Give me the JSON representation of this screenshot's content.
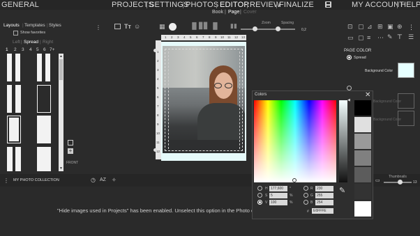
{
  "topnav": {
    "general": "GENERAL",
    "projects": "PROJECTS",
    "settings": "SETTINGS",
    "photos": "PHOTOS",
    "editor": "EDITOR",
    "review": "REVIEW",
    "finalize": "FINALIZE",
    "account": "MY ACCOUNT",
    "help": "HELP",
    "save_icon": "save-icon"
  },
  "subnav": {
    "book": "Book",
    "page": "Page",
    "cover": "Cover"
  },
  "left_tabs": {
    "layouts": "Layouts",
    "templates": "Templates",
    "styles": "Styles"
  },
  "show_favorites": "Show favorites",
  "side_tabs": {
    "left": "Left",
    "spread": "Spread",
    "right": "Right"
  },
  "photo_counts": [
    "1",
    "2",
    "3",
    "4",
    "5",
    "6",
    "7+"
  ],
  "front_label": "FRONT",
  "toolbar": {
    "zoom_label": "Zoom",
    "spacing_label": "Spacing",
    "spacing_value": "0,2"
  },
  "page_numbers": [
    "1",
    "2",
    "3",
    "4",
    "5",
    "6",
    "7",
    "8",
    "9",
    "10",
    "11",
    "12",
    "13"
  ],
  "right_panel": {
    "title": "PAGE COLOR",
    "spread": "Spread",
    "bg_label": "Background Color",
    "bg_label_hidden1": "Background Color",
    "bg_label_hidden2": "Background Color",
    "bg_color": "#E6FFFF"
  },
  "bottombar": {
    "collection": "MY PHOTO COLLECTION",
    "thumbnails": "Thumbnails",
    "thumb_value": "13"
  },
  "notice": "\"Hide images used in Projects\" has been enabled. Unselect this option in the Photo collection.",
  "colors_dialog": {
    "title": "Colors",
    "h_label": "H",
    "h_value": "177,600",
    "h_unit": "°",
    "s_label": "S",
    "s_value": "5",
    "s_unit": "%",
    "v_label": "V",
    "v_value": "100",
    "v_unit": "%",
    "r_label": "R",
    "r_value": "230",
    "g_label": "G",
    "g_value": "255",
    "b_label": "B",
    "b_value": "254",
    "hex_label": "#",
    "hex_value": "E6FFFE",
    "swatches": [
      "#000000",
      "#111111",
      "#e0e0e0",
      "#9a9a9a",
      "#808080",
      "#5c5c5c",
      "#333333",
      "#ffffff"
    ]
  }
}
